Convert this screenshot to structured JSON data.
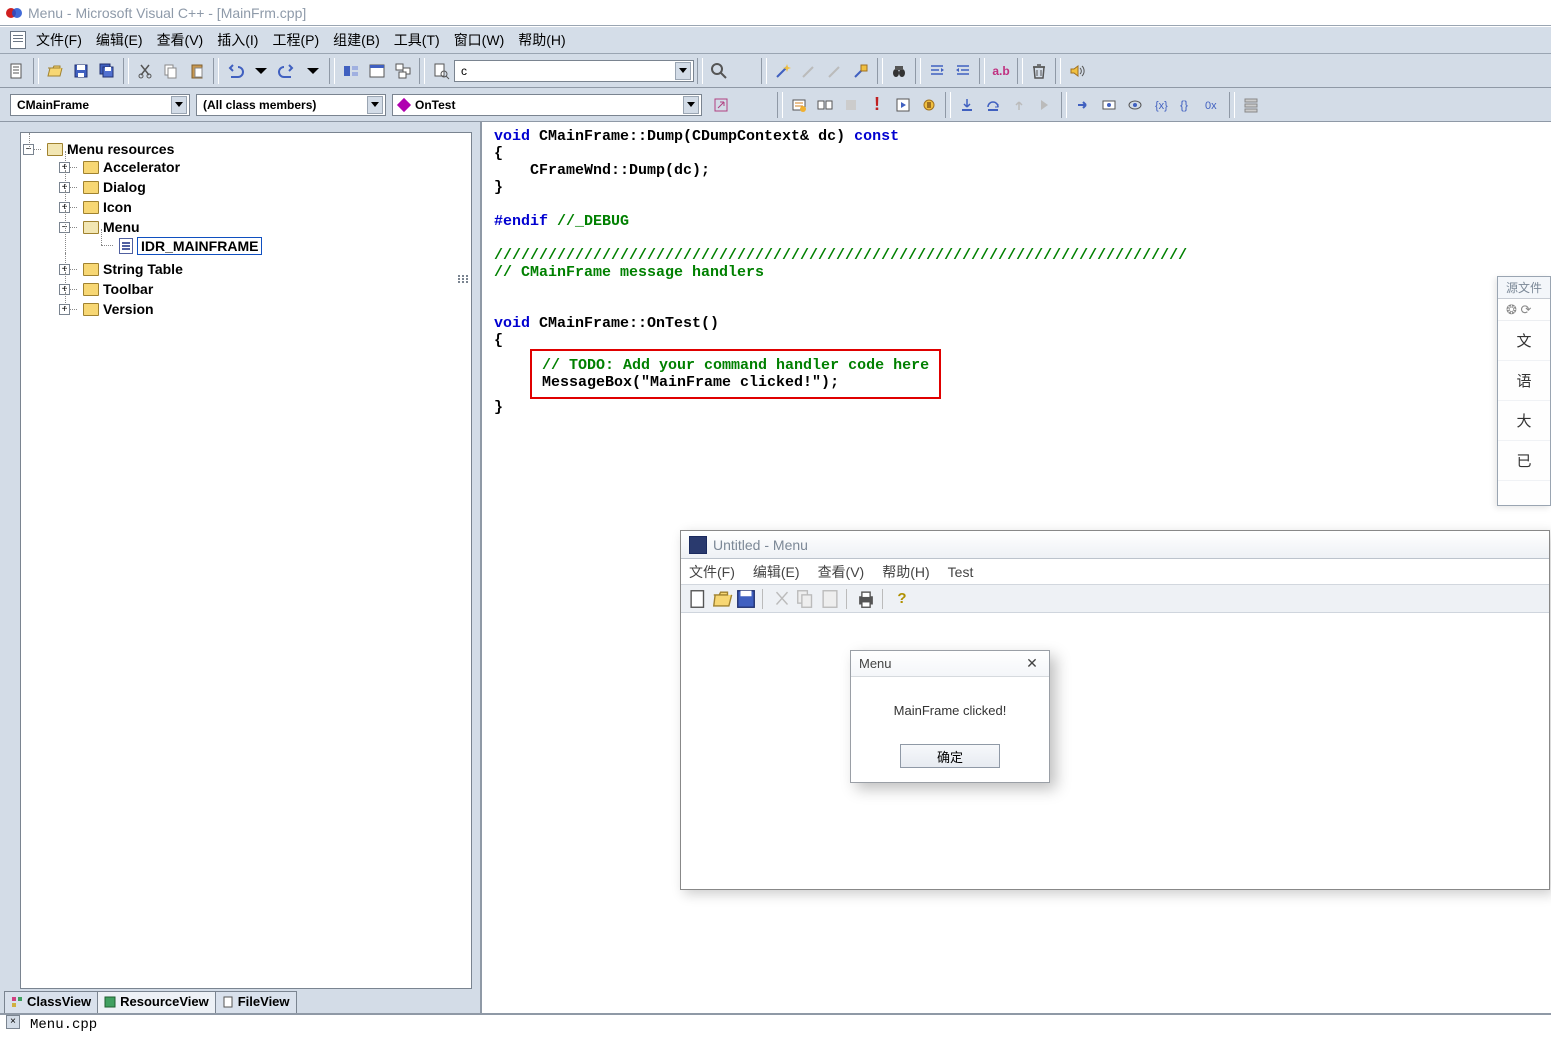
{
  "window": {
    "title": "Menu - Microsoft Visual C++ - [MainFrm.cpp]"
  },
  "menubar": {
    "file": "文件(F)",
    "edit": "编辑(E)",
    "view": "查看(V)",
    "insert": "插入(I)",
    "project": "工程(P)",
    "build": "组建(B)",
    "tools": "工具(T)",
    "window": "窗口(W)",
    "help": "帮助(H)"
  },
  "combos": {
    "findbox": "c",
    "class": "CMainFrame",
    "members": "(All class members)",
    "func": "OnTest"
  },
  "tree": {
    "root": "Menu resources",
    "accelerator": "Accelerator",
    "dialog": "Dialog",
    "icon": "Icon",
    "menu": "Menu",
    "menu_item": "IDR_MAINFRAME",
    "stringtable": "String Table",
    "toolbar": "Toolbar",
    "version": "Version"
  },
  "tabs": {
    "classview": "ClassView",
    "resourceview": "ResourceView",
    "fileview": "FileView"
  },
  "code": {
    "l1a": "void",
    "l1b": " CMainFrame::Dump(CDumpContext& dc) ",
    "l1c": "const",
    "l2": "{",
    "l3": "    CFrameWnd::Dump(dc);",
    "l4": "}",
    "l5": "#endif //_DEBUG",
    "l6": "/////////////////////////////////////////////////////////////////////////////",
    "l7": "// CMainFrame message handlers",
    "l8a": "void",
    "l8b": " CMainFrame::OnTest()",
    "l9": "{",
    "l10": "// TODO: Add your command handler code here",
    "l11": "MessageBox(\"MainFrame clicked!\");",
    "l12": "}"
  },
  "output": {
    "file": "Menu.cpp"
  },
  "app": {
    "title": "Untitled - Menu",
    "file": "文件(F)",
    "edit": "编辑(E)",
    "view": "查看(V)",
    "help": "帮助(H)",
    "test": "Test"
  },
  "msgbox": {
    "title": "Menu",
    "text": "MainFrame clicked!",
    "ok": "确定"
  },
  "sidepanel": {
    "title": "源文件",
    "r1": "文",
    "r2": "语",
    "r3": "大",
    "r4": "已"
  }
}
